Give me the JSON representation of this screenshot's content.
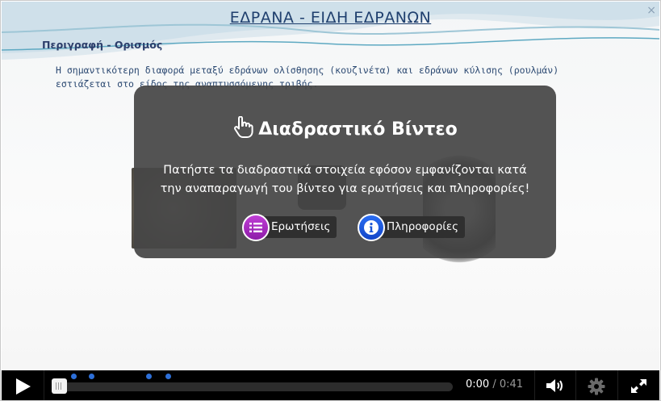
{
  "slide": {
    "title": "ΕΔΡΑΝΑ  -  ΕΙΔΗ ΕΔΡΑΝΩΝ",
    "subtitle": "Περιγραφή - Ορισμός",
    "text_line1": "Η σημαντικότερη διαφορά μεταξύ εδράνων ολίσθησης (κουζινέτα) και εδράνων κύλισης (ρουλμάν)",
    "text_line2": "εστιάζεται στο είδος της αναπτυσσόμενης τριβής.",
    "close_glyph": "×"
  },
  "overlay": {
    "title": "Διαδραστικό Βίντεο",
    "description_line1": "Πατήστε τα διαδραστικά στοιχεία εφόσον εμφανίζονται κατά",
    "description_line2": "την αναπαραγωγή του βίντεο για ερωτήσεις και πληροφορίες!",
    "questions_label": "Ερωτήσεις",
    "info_label": "Πληροφορίες",
    "title_icon": "pointing-hand-icon",
    "questions_icon": "list-icon",
    "info_icon": "info-icon"
  },
  "controls": {
    "current_time": "0:00",
    "separator": "/",
    "duration": "0:41",
    "progress_fraction": 0.0,
    "marker_color": "#2d6fd8",
    "play_icon": "play-icon",
    "volume_icon": "volume-icon",
    "settings_icon": "gear-icon",
    "fullscreen_icon": "fullscreen-icon"
  },
  "colors": {
    "questions_accent": "#9a25b8",
    "info_accent": "#1a55d6",
    "title_color": "#1f3f6e"
  }
}
